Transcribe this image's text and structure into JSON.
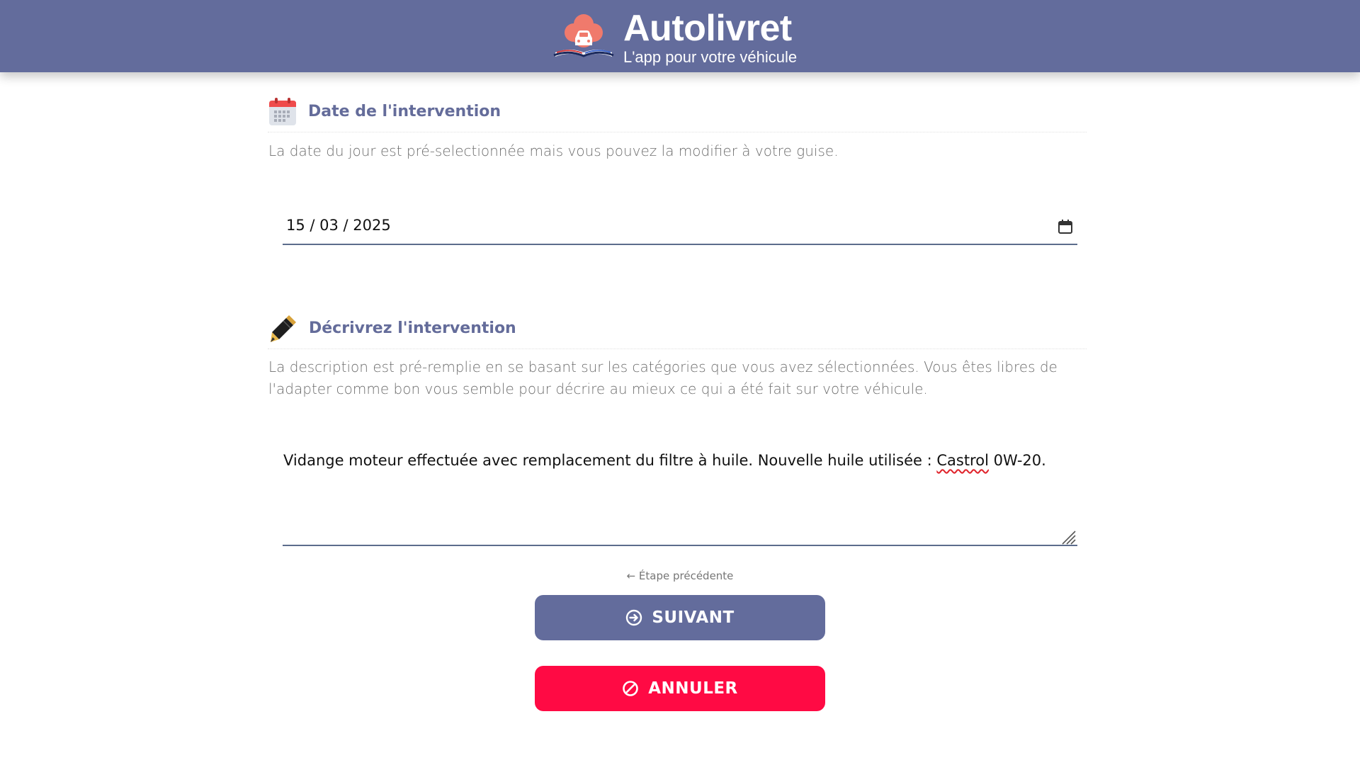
{
  "header": {
    "brand_name": "Autolivret",
    "tagline": "L'app pour votre véhicule",
    "background": "#636c9c"
  },
  "date_section": {
    "icon": "calendar-icon",
    "title": "Date de l'intervention",
    "help": "La date du jour est pré-selectionnée mais vous pouvez la modifier à votre guise.",
    "value": "15 / 03 / 2025"
  },
  "description_section": {
    "icon": "pen-icon",
    "title": "Décrivrez l'intervention",
    "help": "La description est pré-remplie en se basant sur les catégories que vous avez sélectionnées. Vous êtes libres de l'adapter comme bon vous semble pour décrire au mieux ce qui a été fait sur votre véhicule.",
    "value_before": "Vidange moteur effectuée avec remplacement du filtre à huile. Nouvelle huile utilisée : ",
    "value_misspelled": "Castrol",
    "value_after": " 0W-20."
  },
  "navigation": {
    "prev_label": "← Étape précédente",
    "next_label": "SUIVANT",
    "cancel_label": "ANNULER"
  },
  "colors": {
    "accent": "#636c9c",
    "title": "#646c9a",
    "cancel": "#ff0a44"
  }
}
